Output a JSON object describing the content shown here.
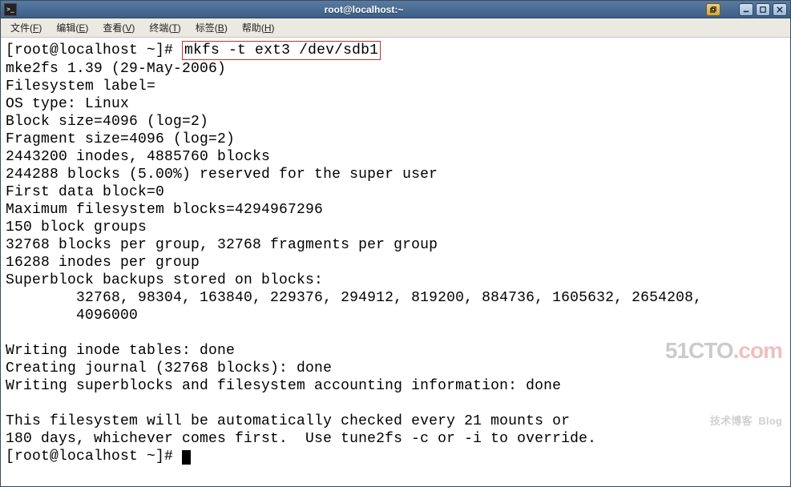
{
  "window": {
    "title": "root@localhost:~"
  },
  "menubar": {
    "items": [
      {
        "label": "文件",
        "accel": "F"
      },
      {
        "label": "编辑",
        "accel": "E"
      },
      {
        "label": "查看",
        "accel": "V"
      },
      {
        "label": "终端",
        "accel": "T"
      },
      {
        "label": "标签",
        "accel": "B"
      },
      {
        "label": "帮助",
        "accel": "H"
      }
    ]
  },
  "terminal": {
    "prompt1_left": "[root@localhost ~]# ",
    "boxed_cmd": "mkfs -t ext3 /dev/sdb1",
    "output": [
      "mke2fs 1.39 (29-May-2006)",
      "Filesystem label=",
      "OS type: Linux",
      "Block size=4096 (log=2)",
      "Fragment size=4096 (log=2)",
      "2443200 inodes, 4885760 blocks",
      "244288 blocks (5.00%) reserved for the super user",
      "First data block=0",
      "Maximum filesystem blocks=4294967296",
      "150 block groups",
      "32768 blocks per group, 32768 fragments per group",
      "16288 inodes per group",
      "Superblock backups stored on blocks: ",
      "        32768, 98304, 163840, 229376, 294912, 819200, 884736, 1605632, 2654208, ",
      "        4096000",
      "",
      "Writing inode tables: done                            ",
      "Creating journal (32768 blocks): done",
      "Writing superblocks and filesystem accounting information: done",
      "",
      "This filesystem will be automatically checked every 21 mounts or",
      "180 days, whichever comes first.  Use tune2fs -c or -i to override."
    ],
    "prompt2": "[root@localhost ~]# "
  },
  "watermark": {
    "domain_main": "51CTO",
    "domain_suffix": ".com",
    "tagline": "技术博客  Blog"
  }
}
